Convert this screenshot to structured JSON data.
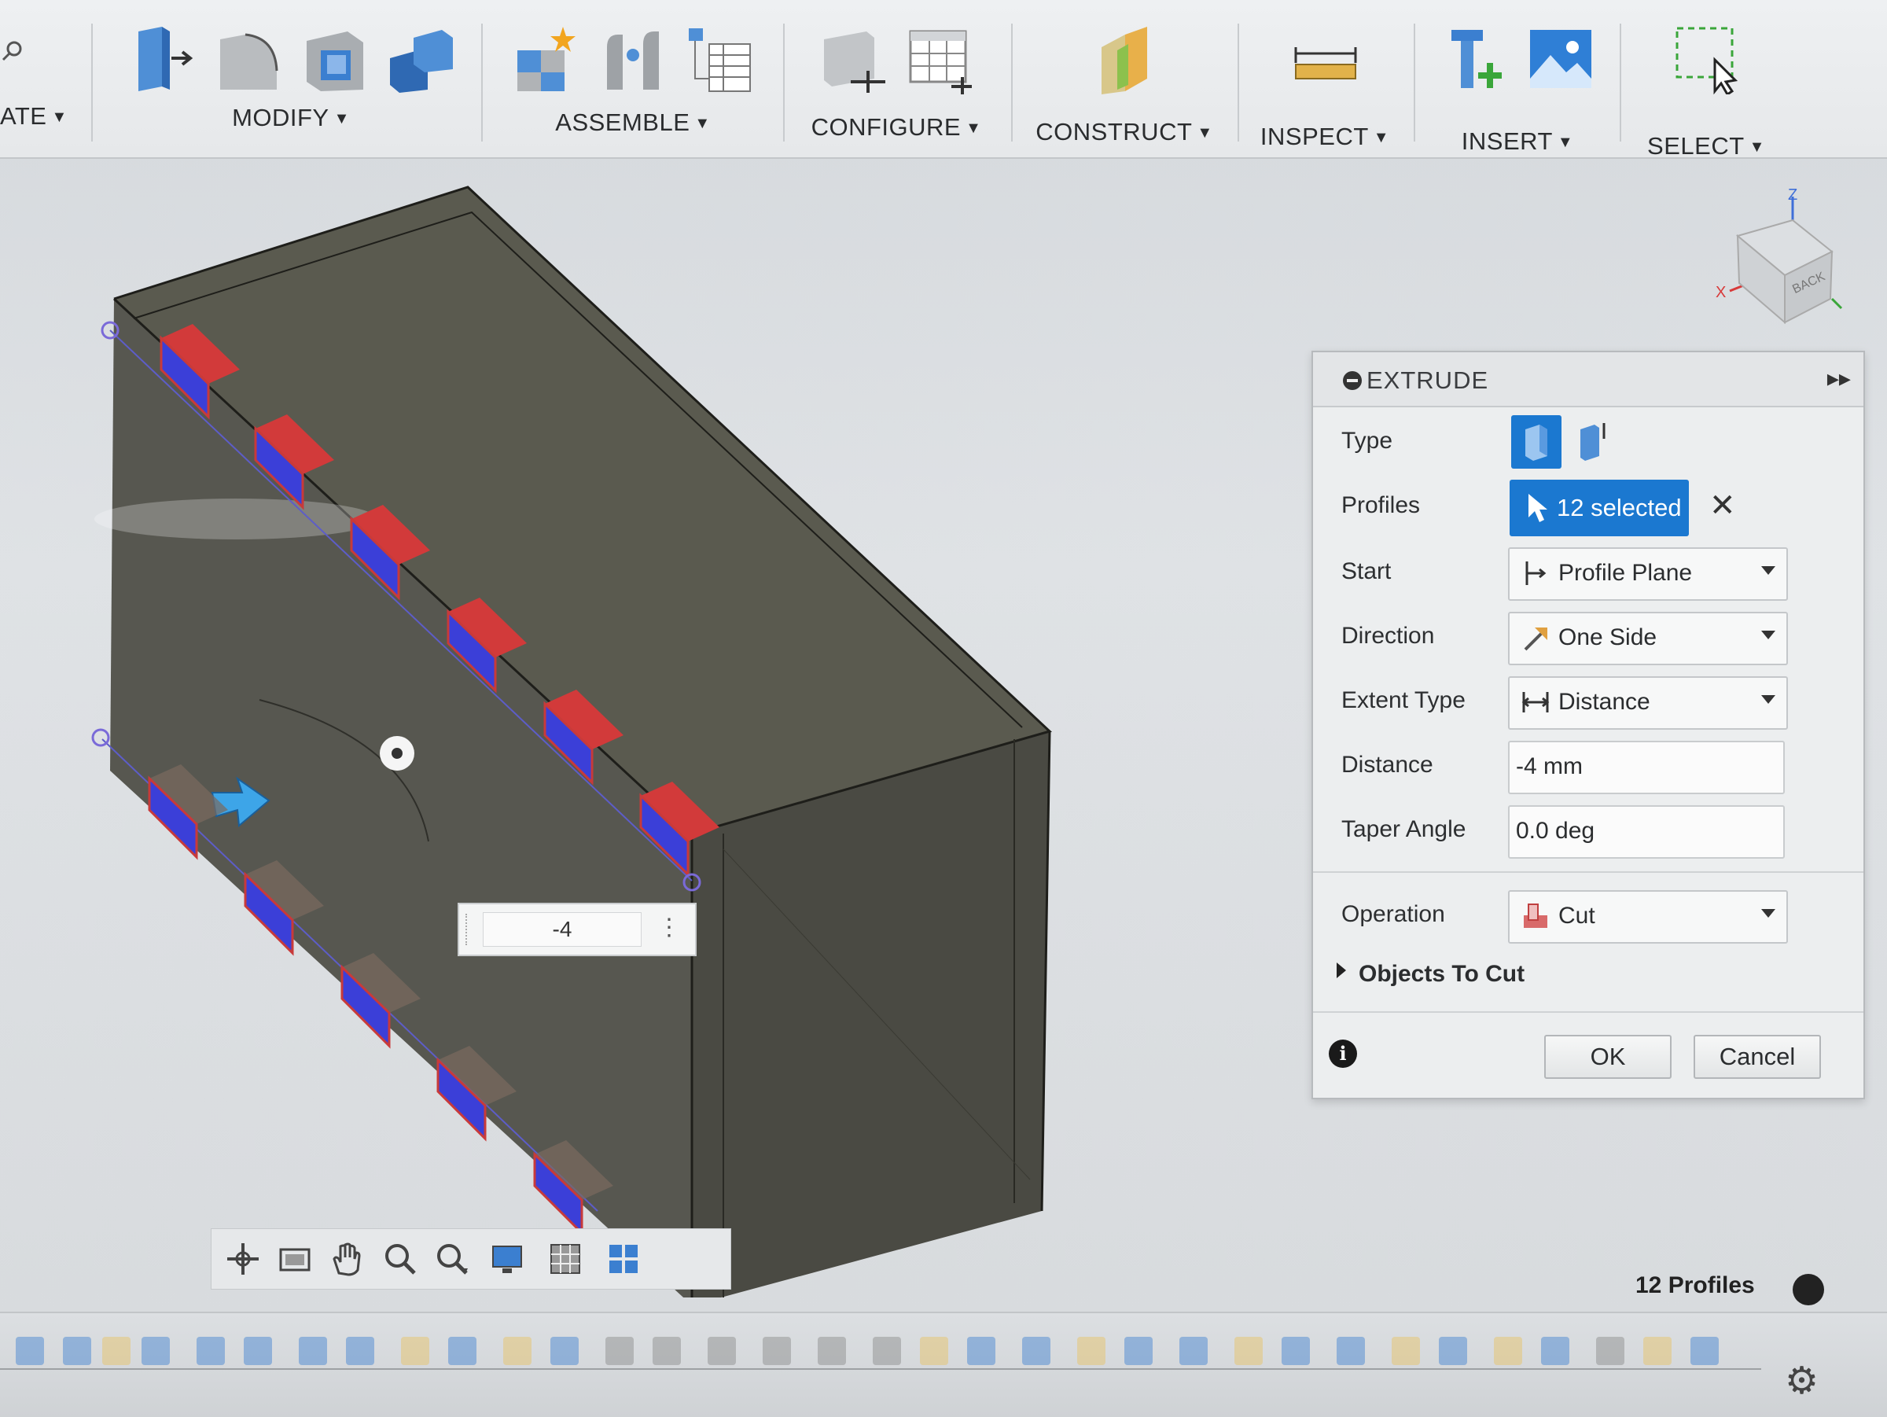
{
  "toolbar": {
    "create_label_partial": "ATE",
    "modify_label": "MODIFY",
    "assemble_label": "ASSEMBLE",
    "configure_label": "CONFIGURE",
    "construct_label": "CONSTRUCT",
    "inspect_label": "INSPECT",
    "insert_label": "INSERT",
    "select_label": "SELECT"
  },
  "viewcube": {
    "face_label": "BACK",
    "axis_z": "Z",
    "axis_x": "X"
  },
  "panel": {
    "title": "EXTRUDE",
    "rows": {
      "type_label": "Type",
      "profiles_label": "Profiles",
      "profiles_value": "12 selected",
      "start_label": "Start",
      "start_value": "Profile Plane",
      "direction_label": "Direction",
      "direction_value": "One Side",
      "extent_label": "Extent Type",
      "extent_value": "Distance",
      "distance_label": "Distance",
      "distance_value": "-4 mm",
      "taper_label": "Taper Angle",
      "taper_value": "0.0 deg",
      "operation_label": "Operation",
      "operation_value": "Cut",
      "objects_label": "Objects To Cut"
    },
    "ok_label": "OK",
    "cancel_label": "Cancel"
  },
  "manipulator": {
    "value": "-4"
  },
  "status": {
    "text": "12 Profiles"
  },
  "colors": {
    "accent": "#1b78d0",
    "profile_red": "#d23a3a",
    "profile_blue": "#3b3fd8",
    "body": "#4a4a42"
  }
}
